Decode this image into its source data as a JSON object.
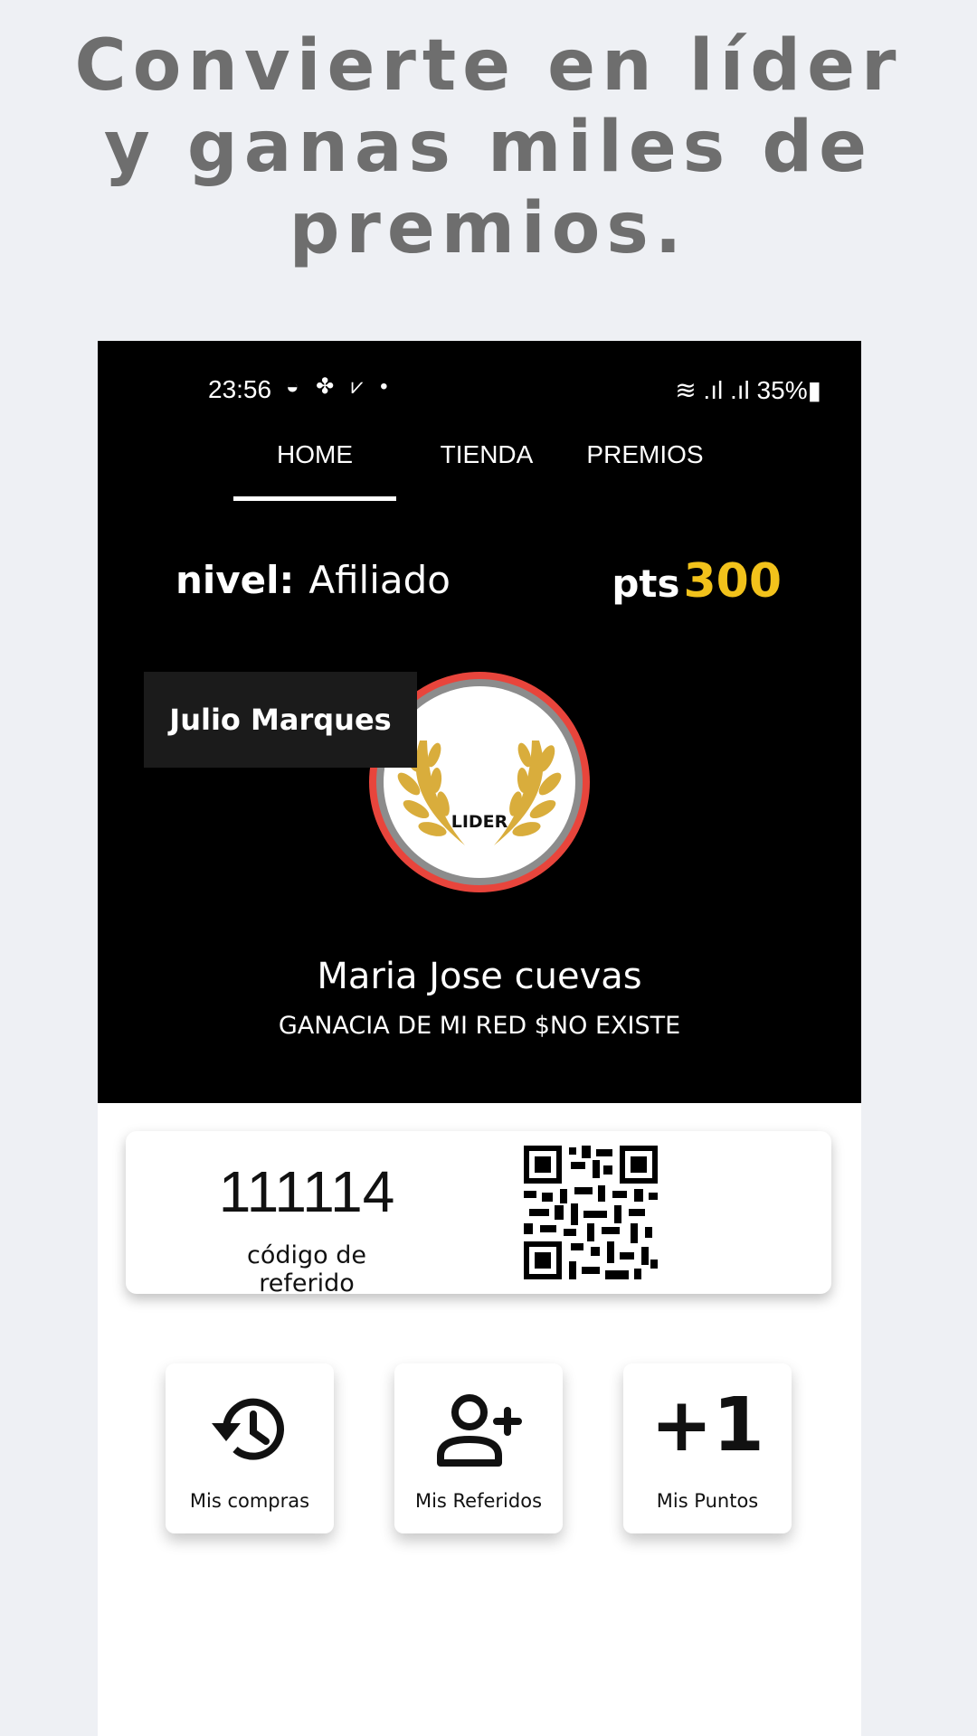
{
  "headline": "Convierte en líder y ganas miles de premios.",
  "status_bar": {
    "time": "23:56",
    "left_icons": "◒ ✤ ⩗ •",
    "right": "≋ .ıl .ıl 35%▮"
  },
  "tabs": [
    {
      "label": "HOME",
      "active": true
    },
    {
      "label": "TIENDA",
      "active": false
    },
    {
      "label": "PREMIOS",
      "active": false
    }
  ],
  "profile": {
    "level_label": "nivel:",
    "level_value": "Afiliado",
    "pts_label": "pts",
    "pts_value": "300",
    "badge_text": "LIDER",
    "tooltip_name": "Julio Marques",
    "user_name": "Maria Jose cuevas",
    "network_gain": "GANACIA DE MI RED $NO EXISTE"
  },
  "referral": {
    "code": "111114",
    "label": "código de referido"
  },
  "actions": [
    {
      "label": "Mis compras",
      "icon": "history-icon"
    },
    {
      "label": "Mis Referidos",
      "icon": "add-user-icon"
    },
    {
      "label": "Mis Puntos",
      "icon": "plus-one-icon",
      "glyph": "+1"
    }
  ],
  "colors": {
    "page_bg": "#eef0f4",
    "headline": "#6e6e6e",
    "points_accent": "#f2c21b",
    "badge_ring": "#e8453c",
    "laurel": "#d9ad3c"
  }
}
